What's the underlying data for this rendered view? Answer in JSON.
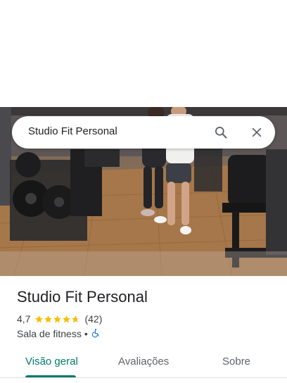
{
  "search": {
    "value": "Studio Fit Personal"
  },
  "icons": {
    "search": "search-icon",
    "close": "close-icon",
    "accessibility": "wheelchair-icon"
  },
  "place": {
    "name": "Studio Fit Personal",
    "rating": "4,7",
    "rating_value": 4.7,
    "rating_max": 5,
    "reviews": "(42)",
    "category": "Sala de fitness",
    "separator": "•"
  },
  "tabs": [
    {
      "label": "Visão geral",
      "active": true
    },
    {
      "label": "Avaliações",
      "active": false
    },
    {
      "label": "Sobre",
      "active": false
    }
  ],
  "colors": {
    "accent": "#00796b",
    "star": "#fbbc04",
    "access": "#1a73e8"
  }
}
